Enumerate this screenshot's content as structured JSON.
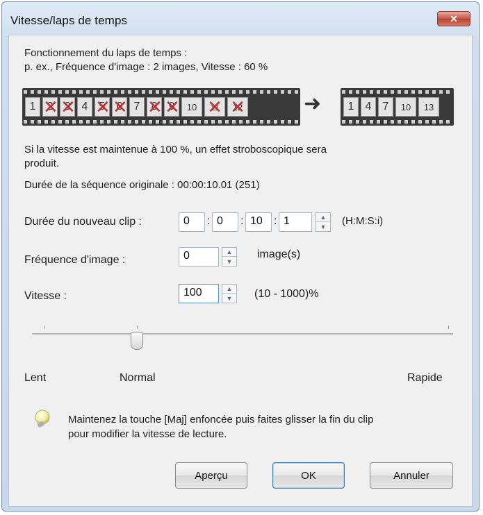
{
  "window": {
    "title": "Vitesse/laps de temps",
    "close_label": "✕"
  },
  "info": {
    "line1": "Fonctionnement du laps de temps :",
    "line2": "p. ex., Fréquence d'image : 2 images, Vitesse : 60 %"
  },
  "filmstrip_left": [
    {
      "label": "1",
      "crossed": false
    },
    {
      "label": "2",
      "crossed": true
    },
    {
      "label": "3",
      "crossed": true
    },
    {
      "label": "4",
      "crossed": false
    },
    {
      "label": "5",
      "crossed": true
    },
    {
      "label": "6",
      "crossed": true
    },
    {
      "label": "7",
      "crossed": false
    },
    {
      "label": "8",
      "crossed": true
    },
    {
      "label": "9",
      "crossed": true
    },
    {
      "label": "10",
      "crossed": false
    },
    {
      "label": "11",
      "crossed": true
    },
    {
      "label": "12",
      "crossed": true
    }
  ],
  "filmstrip_right": [
    "1",
    "4",
    "7",
    "10",
    "13"
  ],
  "note": {
    "line1": "Si la vitesse est maintenue à 100 %, un effet stroboscopique sera",
    "line2": "produit."
  },
  "original_duration": "Durée de la séquence originale : 00:00:10.01 (251)",
  "new_clip": {
    "label": "Durée du nouveau clip :",
    "hours": "0",
    "minutes": "0",
    "seconds": "10",
    "frames": "1",
    "unit": "(H:M:S:i)"
  },
  "frame_rate": {
    "label": "Fréquence d'image :",
    "value": "0",
    "unit": "image(s)"
  },
  "speed": {
    "label": "Vitesse :",
    "value": "100",
    "unit": "(10 - 1000)%"
  },
  "slider": {
    "min_label": "Lent",
    "mid_label": "Normal",
    "max_label": "Rapide"
  },
  "tip": {
    "line1": "Maintenez la touche [Maj] enfoncée puis faites glisser la fin du clip",
    "line2": "pour modifier la vitesse de lecture."
  },
  "buttons": {
    "preview": "Aperçu",
    "ok": "OK",
    "cancel": "Annuler"
  }
}
